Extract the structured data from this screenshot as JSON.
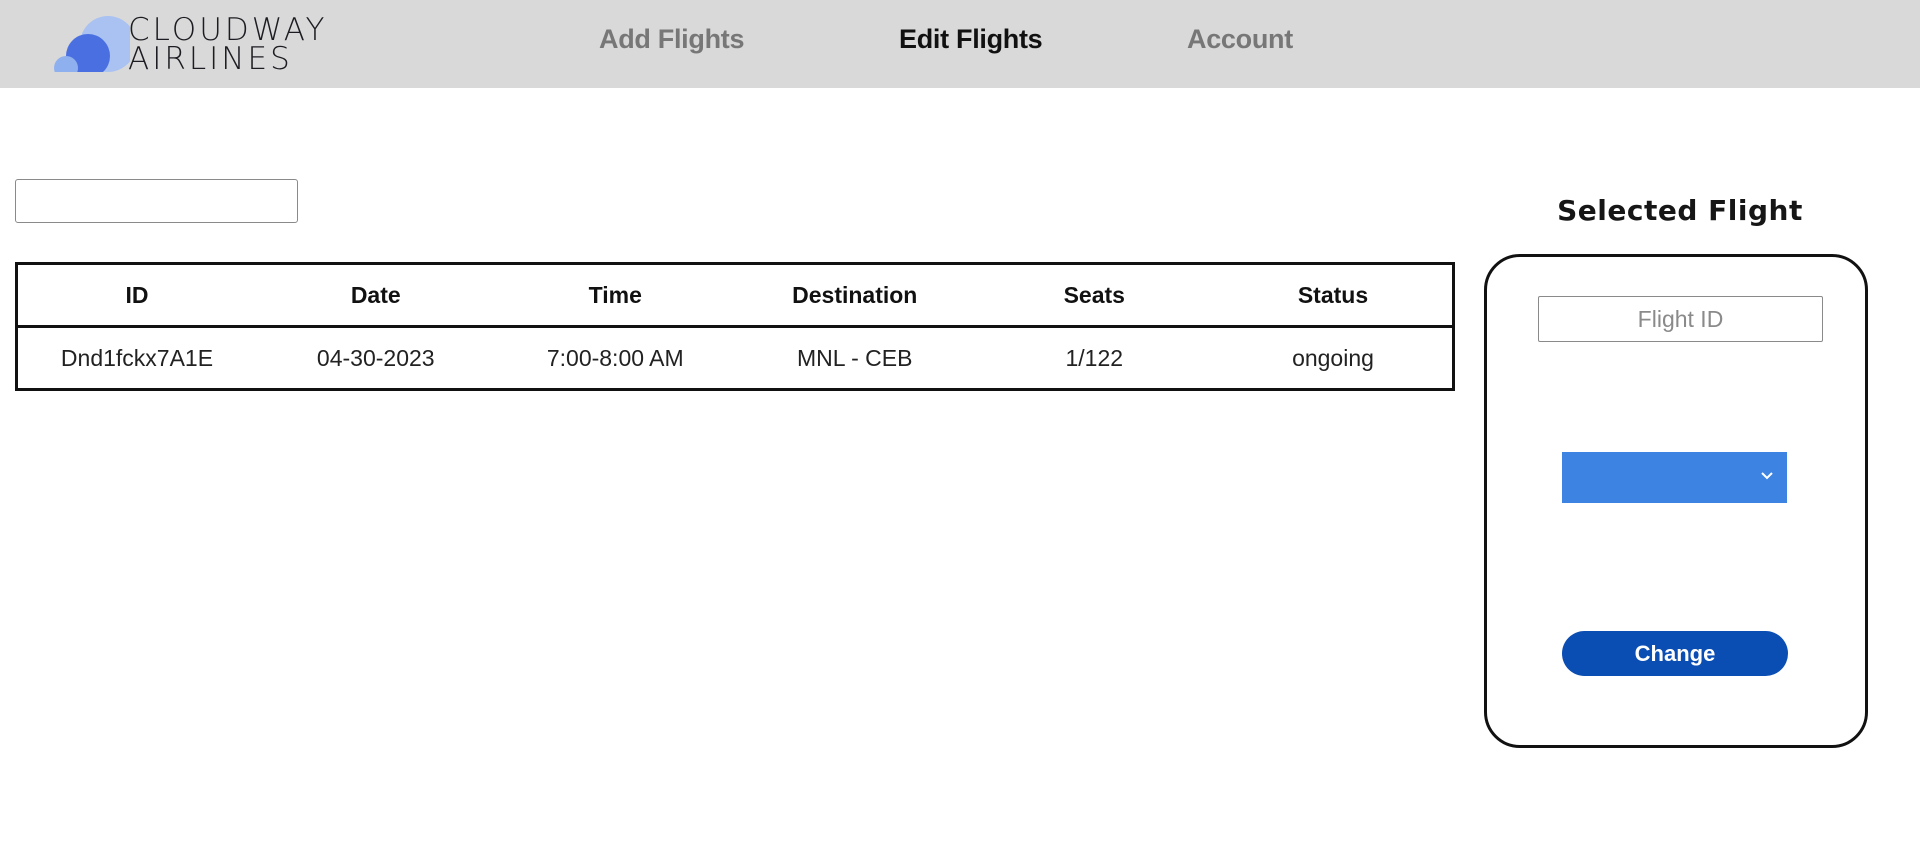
{
  "brand": {
    "line1": "CLOUDWAY",
    "line2": "AIRLINES",
    "logo_colors": [
      "#4a6fe0",
      "#8fb0ee",
      "#a9c2f2"
    ]
  },
  "nav": {
    "add_flights": "Add Flights",
    "edit_flights": "Edit Flights",
    "account": "Account",
    "active": "edit_flights"
  },
  "search": {
    "value": "",
    "placeholder": ""
  },
  "table": {
    "headers": [
      "ID",
      "Date",
      "Time",
      "Destination",
      "Seats",
      "Status"
    ],
    "rows": [
      [
        "Dnd1fckx7A1E",
        "04-30-2023",
        "7:00-8:00 AM",
        "MNL - CEB",
        "1/122",
        "ongoing"
      ]
    ]
  },
  "selected_flight": {
    "title": "Selected Flight",
    "flight_id_placeholder": "Flight ID",
    "flight_id_value": "",
    "status_selected": "",
    "change_label": "Change",
    "select_color": "#3c83e2",
    "button_color": "#0a4db3",
    "select_icon": "chevron-down-icon"
  }
}
